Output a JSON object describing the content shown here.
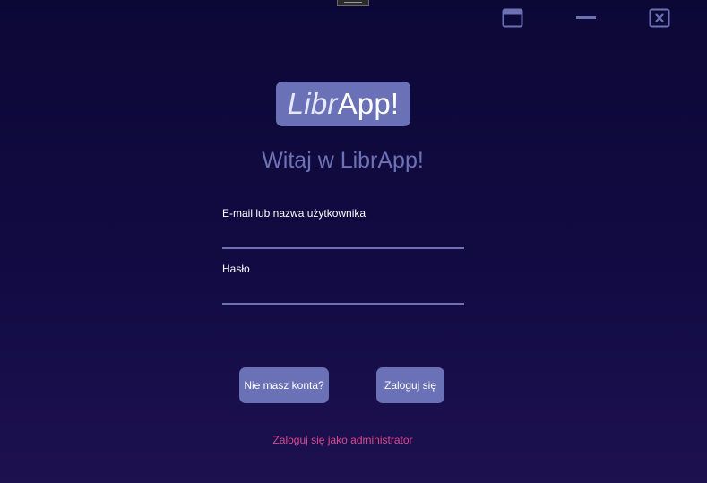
{
  "window": {
    "drag_handle_icon": "drag-handle-icon",
    "maximize_icon": "maximize-icon",
    "minimize_icon": "minimize-icon",
    "close_icon": "close-icon",
    "icon_color": "#6c71b6"
  },
  "logo": {
    "light_text": "Libr",
    "bold_text": "App!"
  },
  "welcome": "Witaj w LibrApp!",
  "form": {
    "email_label": "E-mail lub nazwa użytkownika",
    "email_value": "",
    "password_label": "Hasło",
    "password_value": ""
  },
  "buttons": {
    "register": "Nie masz konta?",
    "login": "Zaloguj się"
  },
  "admin_link": "Zaloguj się jako administrator",
  "colors": {
    "background_top": "#0c0836",
    "background_bottom": "#1d1150",
    "accent": "#6a71b7",
    "link": "#e0478e"
  }
}
